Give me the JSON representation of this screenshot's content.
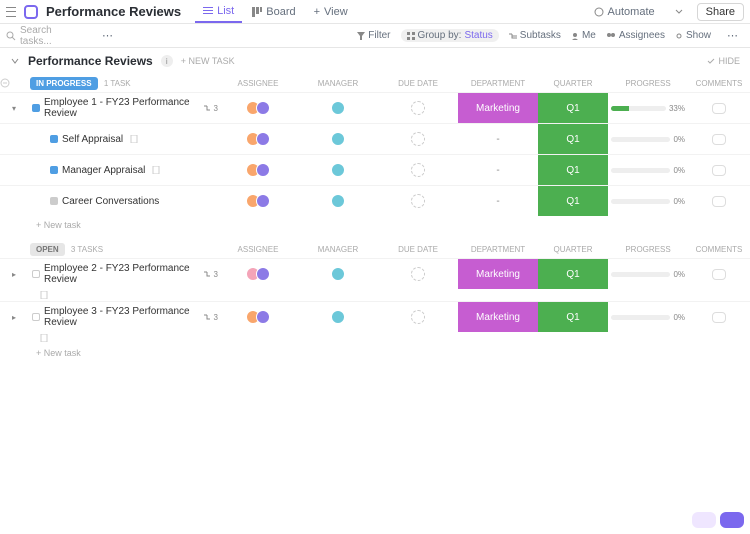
{
  "header": {
    "title": "Performance Reviews",
    "tabs": {
      "list": "List",
      "board": "Board",
      "view": "View"
    },
    "automate": "Automate",
    "share": "Share"
  },
  "search": {
    "placeholder": "Search tasks..."
  },
  "filterbar": {
    "filter": "Filter",
    "group_by": "Group by:",
    "group_value": "Status",
    "subtasks": "Subtasks",
    "me": "Me",
    "assignees": "Assignees",
    "show": "Show"
  },
  "section": {
    "name": "Performance Reviews",
    "add": "+ NEW TASK",
    "hide": "HIDE"
  },
  "columns": {
    "assignee": "ASSIGNEE",
    "manager": "MANAGER",
    "due": "DUE DATE",
    "dept": "DEPARTMENT",
    "qtr": "QUARTER",
    "prog": "PROGRESS",
    "comm": "COMMENTS"
  },
  "groups": {
    "in_progress": {
      "label": "IN PROGRESS",
      "count": "1 TASK"
    },
    "open": {
      "label": "OPEN",
      "count": "3 TASKS"
    }
  },
  "tasks": {
    "e1": {
      "name": "Employee 1 - FY23 Performance Review",
      "sub": "3",
      "dept": "Marketing",
      "qtr": "Q1",
      "pct": "33%",
      "pw": 33
    },
    "s1": {
      "name": "Self Appraisal",
      "qtr": "Q1",
      "pct": "0%"
    },
    "s2": {
      "name": "Manager Appraisal",
      "qtr": "Q1",
      "pct": "0%"
    },
    "s3": {
      "name": "Career Conversations",
      "qtr": "Q1",
      "pct": "0%"
    },
    "e2": {
      "name": "Employee 2 - FY23 Performance Review",
      "sub": "3",
      "dept": "Marketing",
      "qtr": "Q1",
      "pct": "0%"
    },
    "e3": {
      "name": "Employee 3 - FY23 Performance Review",
      "sub": "3",
      "dept": "Marketing",
      "qtr": "Q1",
      "pct": "0%"
    }
  },
  "newtask": "+ New task",
  "dash": "-",
  "chart_data": {
    "type": "table",
    "title": "Performance Reviews",
    "columns": [
      "Task",
      "Assignee",
      "Manager",
      "Due Date",
      "Department",
      "Quarter",
      "Progress",
      "Comments"
    ],
    "rows": [
      [
        "Employee 1 - FY23 Performance Review",
        "2 users",
        "1 user",
        "",
        "Marketing",
        "Q1",
        33,
        ""
      ],
      [
        "Self Appraisal",
        "2 users",
        "1 user",
        "",
        "-",
        "Q1",
        0,
        ""
      ],
      [
        "Manager Appraisal",
        "2 users",
        "1 user",
        "",
        "-",
        "Q1",
        0,
        ""
      ],
      [
        "Career Conversations",
        "2 users",
        "1 user",
        "",
        "-",
        "Q1",
        0,
        ""
      ],
      [
        "Employee 2 - FY23 Performance Review",
        "2 users",
        "1 user",
        "",
        "Marketing",
        "Q1",
        0,
        ""
      ],
      [
        "Employee 3 - FY23 Performance Review",
        "2 users",
        "1 user",
        "",
        "Marketing",
        "Q1",
        0,
        ""
      ]
    ]
  }
}
